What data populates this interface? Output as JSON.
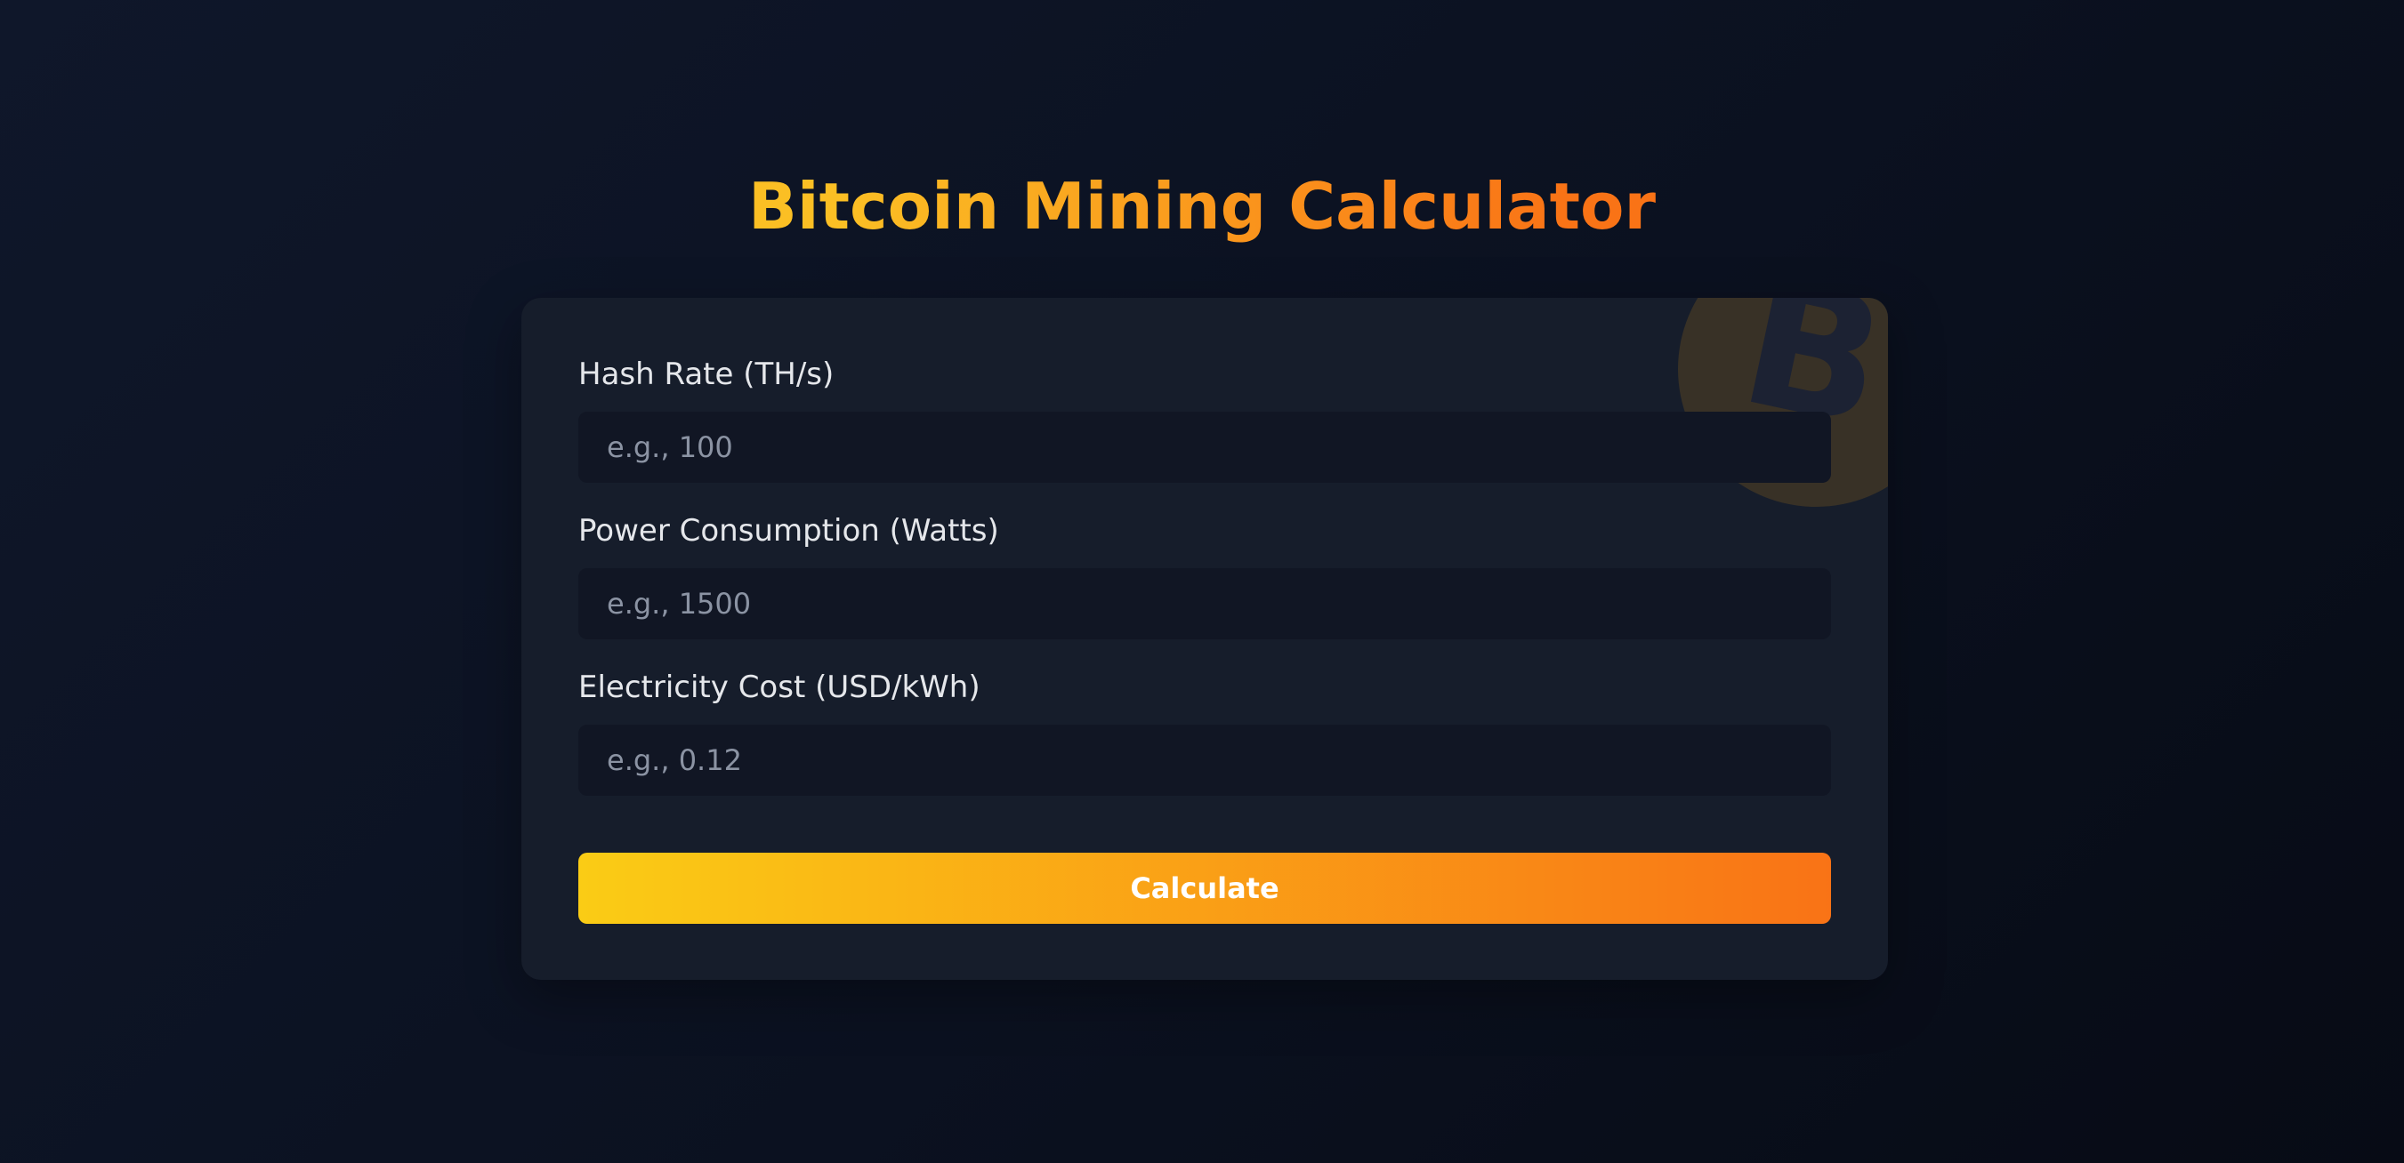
{
  "page": {
    "title": "Bitcoin Mining Calculator"
  },
  "form": {
    "hash_rate": {
      "label": "Hash Rate (TH/s)",
      "placeholder": "e.g., 100",
      "value": ""
    },
    "power": {
      "label": "Power Consumption (Watts)",
      "placeholder": "e.g., 1500",
      "value": ""
    },
    "electricity": {
      "label": "Electricity Cost (USD/kWh)",
      "placeholder": "e.g., 0.12",
      "value": ""
    },
    "submit_label": "Calculate"
  },
  "icons": {
    "background": "bitcoin-icon"
  },
  "colors": {
    "background": "#0b1120",
    "card": "#161d2b",
    "input": "#111624",
    "accent_start": "#facc15",
    "accent_end": "#f97316"
  }
}
